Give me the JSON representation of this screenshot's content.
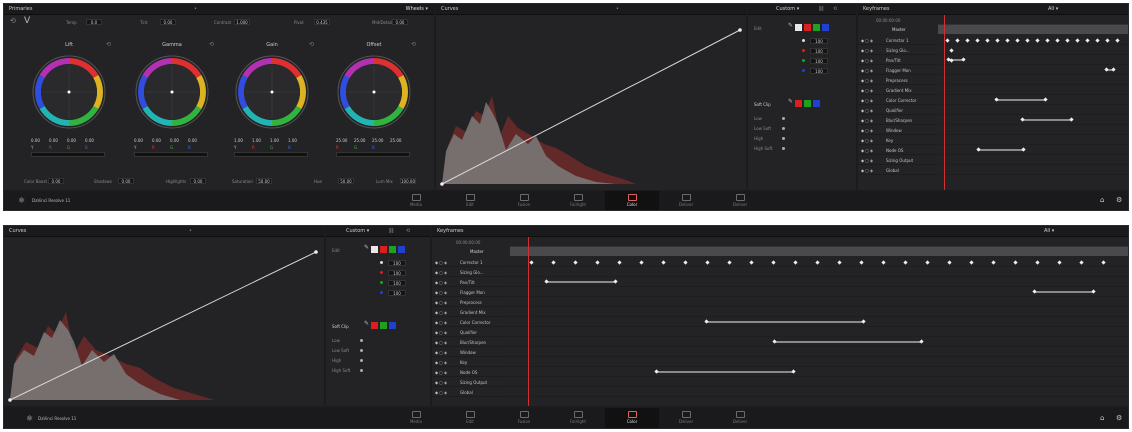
{
  "colors": {
    "background": "#1c1c1e",
    "panel": "#232326",
    "header": "#1a1a1c",
    "playhead": "#d03030",
    "red": "#d82020",
    "green": "#20a020",
    "blue": "#2040d0"
  },
  "top": {
    "primaries": {
      "title": "Primaries",
      "mode": "Wheels",
      "topbar": [
        {
          "label": "Temp",
          "value": "0.0"
        },
        {
          "label": "Tint",
          "value": "0.00"
        },
        {
          "label": "Contrast",
          "value": "1.000"
        },
        {
          "label": "Pivot",
          "value": "0.435"
        },
        {
          "label": "Mid/Detail",
          "value": "0.00"
        }
      ],
      "wheels": [
        {
          "name": "Lift",
          "values": [
            "0.00",
            "0.00",
            "0.00",
            "0.00"
          ],
          "channels": [
            "Y",
            "R",
            "G",
            "B"
          ]
        },
        {
          "name": "Gamma",
          "values": [
            "0.00",
            "0.00",
            "0.00",
            "0.00"
          ],
          "channels": [
            "Y",
            "R",
            "G",
            "B"
          ]
        },
        {
          "name": "Gain",
          "values": [
            "1.00",
            "1.00",
            "1.00",
            "1.00"
          ],
          "channels": [
            "Y",
            "R",
            "G",
            "B"
          ]
        },
        {
          "name": "Offset",
          "values": [
            "25.00",
            "25.00",
            "25.00",
            "25.00"
          ],
          "channels": [
            "R",
            "G",
            "B"
          ]
        }
      ],
      "bottombar": [
        {
          "label": "Color Boost",
          "value": "0.00"
        },
        {
          "label": "Shadows",
          "value": "0.00"
        },
        {
          "label": "Highlights",
          "value": "0.00"
        },
        {
          "label": "Saturation",
          "value": "50.00"
        },
        {
          "label": "Hue",
          "value": "50.00"
        },
        {
          "label": "Lum Mix",
          "value": "100.00"
        }
      ]
    },
    "curves": {
      "title": "Curves"
    },
    "curvesctl": {
      "title": "Custom",
      "editlabel": "Edit",
      "rows": [
        "100",
        "100",
        "100",
        "100"
      ],
      "softclip": "Soft Clip",
      "softlabels": [
        "Low",
        "Low Soft",
        "High",
        "High Soft"
      ]
    },
    "keyframes": {
      "title": "Keyframes",
      "filter": "All",
      "colhead": "00:00:00:00",
      "master": "Master",
      "tracks": [
        "Corrector 1",
        "Sizing Glo...",
        "Pan/Tilt",
        "Flagger Mon",
        "Preprocess",
        "Gradient Mix",
        "Color Corrector",
        "Qualifier",
        "Blur/Sharpen",
        "Window",
        "Key",
        "Node OS",
        "Sizing Output",
        "Global"
      ]
    },
    "footer": {
      "brand": "DaVinci Resolve 11",
      "pages": [
        "Media",
        "Edit",
        "Fusion",
        "Fairlight",
        "Color",
        "Deliver",
        "Deliver"
      ]
    }
  },
  "bottom": {
    "curves": {
      "title": "Curves"
    },
    "curvesctl": {
      "title": "Custom",
      "editlabel": "Edit",
      "rows": [
        "100",
        "100",
        "100",
        "100"
      ],
      "softclip": "Soft Clip",
      "softlabels": [
        "Low",
        "Low Soft",
        "High",
        "High Soft"
      ]
    },
    "keyframes": {
      "title": "Keyframes",
      "filter": "All",
      "colhead": "00:00:00:00",
      "master": "Master",
      "tracks": [
        "Corrector 1",
        "Sizing Glo...",
        "Pan/Tilt",
        "Flagger Mon",
        "Preprocess",
        "Gradient Mix",
        "Color Corrector",
        "Qualifier",
        "Blur/Sharpen",
        "Window",
        "Key",
        "Node OS",
        "Sizing Output",
        "Global"
      ]
    },
    "footer": {
      "brand": "DaVinci Resolve 11",
      "pages": [
        "Media",
        "Edit",
        "Fusion",
        "Fairlight",
        "Color",
        "Deliver",
        "Deliver"
      ]
    }
  }
}
